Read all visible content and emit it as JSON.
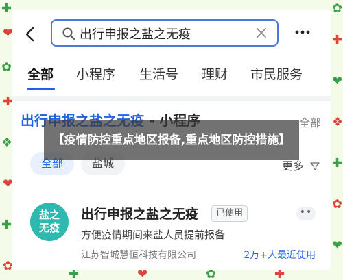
{
  "search": {
    "query": "出行申报之盐之无疫"
  },
  "tabs": [
    {
      "label": "全部",
      "active": true
    },
    {
      "label": "小程序",
      "active": false
    },
    {
      "label": "生活号",
      "active": false
    },
    {
      "label": "理财",
      "active": false
    },
    {
      "label": "市民服务",
      "active": false
    }
  ],
  "section": {
    "title": "出行申报之盐之无疫",
    "suffix": " - 小程序",
    "all_label": "全部"
  },
  "filters": {
    "chips": [
      {
        "label": "全部",
        "active": true
      },
      {
        "label": "盐城",
        "active": false
      }
    ],
    "more_label": "更多"
  },
  "result": {
    "logo_line1": "盐之",
    "logo_line2": "无疫",
    "name": "出行申报之盐之无疫",
    "badge": "已使用",
    "more": "••",
    "description": "方便疫情期间来盐人员提前报备",
    "company": "江苏智城慧恒科技有限公司",
    "usage": "2万+人最近使用"
  },
  "banner": {
    "text": "【疫情防控重点地区报备,重点地区防控措施】"
  },
  "colors": {
    "accent": "#1f63e6",
    "search_border": "#4a7bd8",
    "logo_bg": "#2fb8b0",
    "border_green": "#3aa14a",
    "border_red": "#e0423c"
  },
  "icons": [
    "back-icon",
    "search-icon",
    "clear-icon",
    "more-icon",
    "filter-icon"
  ]
}
